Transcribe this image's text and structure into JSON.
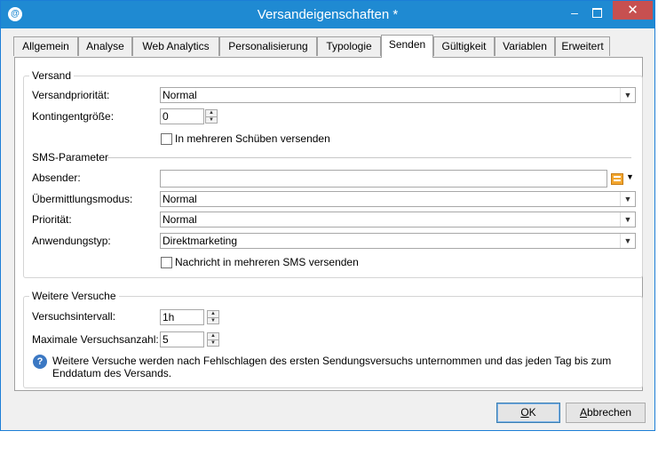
{
  "window": {
    "title": "Versandeigenschaften *",
    "app_icon": "app-icon"
  },
  "tabs": [
    {
      "label": "Allgemein"
    },
    {
      "label": "Analyse"
    },
    {
      "label": "Web Analytics"
    },
    {
      "label": "Personalisierung"
    },
    {
      "label": "Typologie"
    },
    {
      "label": "Senden",
      "active": true
    },
    {
      "label": "Gültigkeit"
    },
    {
      "label": "Variablen"
    },
    {
      "label": "Erweitert"
    }
  ],
  "versand": {
    "title": "Versand",
    "priority_label": "Versandpriorität:",
    "priority_value": "Normal",
    "quota_label": "Kontingentgröße:",
    "quota_value": "0",
    "batches_checkbox": "In mehreren Schüben versenden",
    "batches_checked": false
  },
  "sms": {
    "title": "SMS-Parameter",
    "sender_label": "Absender:",
    "sender_value": "",
    "mode_label": "Übermittlungsmodus:",
    "mode_value": "Normal",
    "priority_label": "Priorität:",
    "priority_value": "Normal",
    "apptype_label": "Anwendungstyp:",
    "apptype_value": "Direktmarketing",
    "multi_sms_checkbox": "Nachricht in mehreren SMS versenden",
    "multi_sms_checked": false
  },
  "retries": {
    "title": "Weitere Versuche",
    "interval_label": "Versuchsintervall:",
    "interval_value": "1h",
    "max_label": "Maximale Versuchsanzahl:",
    "max_value": "5",
    "info_line1": "Weitere Versuche werden nach Fehlschlagen des ersten Sendungsversuchs unternommen und das jeden Tag bis zum",
    "info_line2": "Enddatum des Versands."
  },
  "buttons": {
    "ok": "OK",
    "cancel": "Abbrechen"
  }
}
